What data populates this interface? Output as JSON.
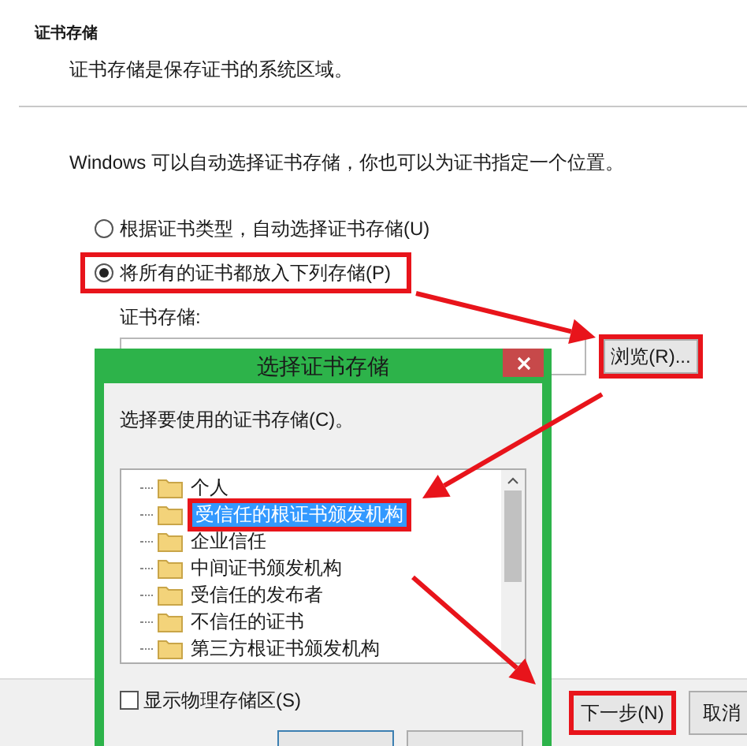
{
  "wizard": {
    "heading": "证书存储",
    "description": "证书存储是保存证书的系统区域。",
    "instruction": "Windows 可以自动选择证书存储，你也可以为证书指定一个位置。",
    "options": [
      {
        "label": "根据证书类型，自动选择证书存储(U)",
        "selected": false,
        "highlighted": false
      },
      {
        "label": "将所有的证书都放入下列存储(P)",
        "selected": true,
        "highlighted": true
      }
    ],
    "store_label": "证书存储:",
    "browse_button": "浏览(R)...",
    "footer_buttons": [
      {
        "label": "下一步(N)",
        "highlighted": true
      },
      {
        "label": "取消",
        "highlighted": false
      }
    ]
  },
  "dialog": {
    "title": "选择证书存储",
    "prompt": "选择要使用的证书存储(C)。",
    "stores": [
      {
        "label": "个人",
        "selected": false
      },
      {
        "label": "受信任的根证书颁发机构",
        "selected": true
      },
      {
        "label": "企业信任",
        "selected": false
      },
      {
        "label": "中间证书颁发机构",
        "selected": false
      },
      {
        "label": "受信任的发布者",
        "selected": false
      },
      {
        "label": "不信任的证书",
        "selected": false
      },
      {
        "label": "第三方根证书颁发机构",
        "selected": false
      }
    ],
    "show_physical": {
      "label": "显示物理存储区(S)",
      "checked": false
    }
  }
}
